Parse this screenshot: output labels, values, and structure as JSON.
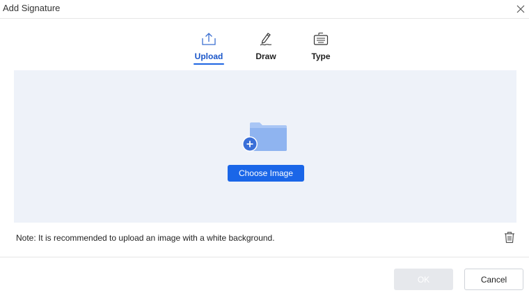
{
  "dialog": {
    "title": "Add Signature",
    "close_icon": "close-icon"
  },
  "tabs": [
    {
      "label": "Upload",
      "icon": "upload-icon",
      "active": true
    },
    {
      "label": "Draw",
      "icon": "pen-draw-icon",
      "active": false
    },
    {
      "label": "Type",
      "icon": "keyboard-type-icon",
      "active": false
    }
  ],
  "upload": {
    "folder_icon": "folder-add-icon",
    "choose_label": "Choose Image",
    "note": "Note: It is recommended to upload an image with a white background.",
    "trash_icon": "trash-icon"
  },
  "footer": {
    "ok_label": "OK",
    "ok_enabled": false,
    "cancel_label": "Cancel"
  },
  "colors": {
    "accent": "#1a66e8",
    "drop_area_bg": "#eef2f9",
    "folder_light": "#a9c6f5",
    "folder_dark": "#3a6fd8",
    "disabled_button": "#e6e8ec"
  }
}
